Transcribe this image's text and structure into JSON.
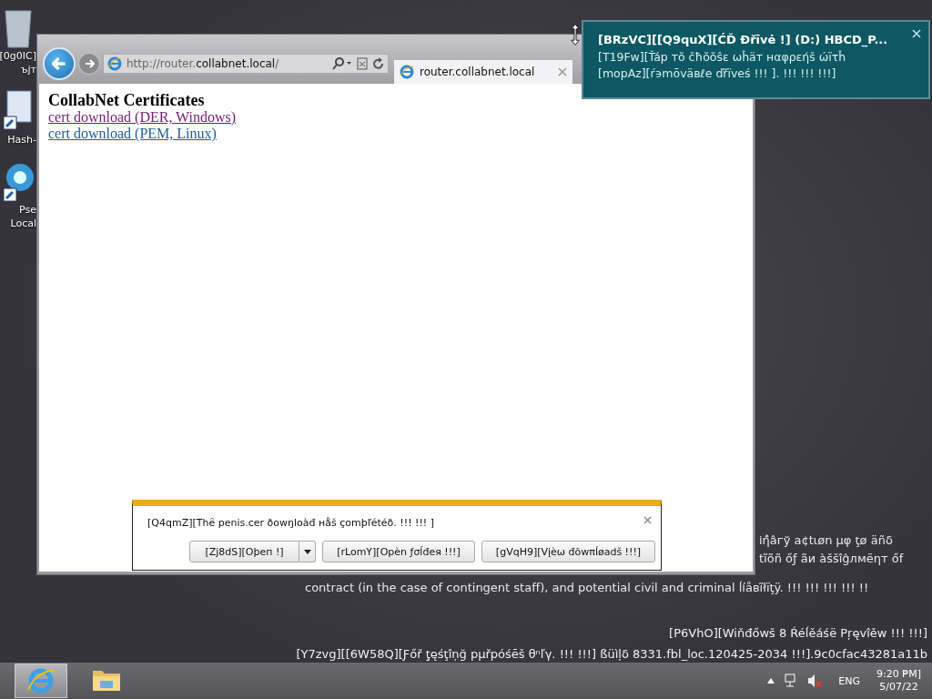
{
  "desktop": {
    "icons": [
      {
        "kind": "bin",
        "lines": [
          "[0g0IC]",
          "ъjт"
        ]
      },
      {
        "kind": "shortcut",
        "lines": [
          "Hash-"
        ]
      },
      {
        "kind": "ie",
        "lines": [
          "Pse",
          "Local"
        ]
      }
    ],
    "legal_lines": [
      "іή̂âгў a¢tιøn µφ ţø äñδ",
      "tĩõñ őƒ ãи àššîĝлмëηт őf",
      "contract (in the case of contingent staff), and potential civil and criminal ĺíåвĩłïţÿ. !!! !!! !!! !!! !!"
    ],
    "build_lines": [
      "[P6VhO][Wiňđőwš 8 Ŕéĺěáśë Pŗęvîěw !!! !!!]",
      "[Y7zvg][[6W58Q][Ƒőř ţ̧ęśţîņğ pµřpóśēš θⁿľγ. !!! !!!] ßüìļδ 8331.fbl_loc.120425-2034 !!!].9c0cfac43281a11b"
    ]
  },
  "browser": {
    "url": {
      "prefix": "http://router.",
      "domain": "collabnet.local",
      "suffix": "/"
    },
    "tab": {
      "title": "router.collabnet.local",
      "selected": true
    },
    "page": {
      "heading": "CollabNet Certificates",
      "links": [
        {
          "text": "cert download (DER, Windows)",
          "visited": true
        },
        {
          "text": "cert download (PEM, Linux)",
          "visited": false
        }
      ]
    }
  },
  "download_bar": {
    "message": "[Q4qmZ][Thȇ penis.cer ðowŋloàđ нåš çomþľétéð. !!! !!! ]",
    "buttons": [
      {
        "kind": "split",
        "label": "[Zj8dS][Oþeп !]"
      },
      {
        "kind": "plain",
        "label": "[rLomY][Opèn ƒσĺđeя !!!]"
      },
      {
        "kind": "plain",
        "label": "[gVqH9][Vįèω đõwπĺøadš !!!]"
      }
    ]
  },
  "notification": {
    "title": "[BRzVC][[Q9quX][ĆĎ Đřīvė !] (D:) HBCD_P...",
    "body": "[T19Fw][Ťáp тŏ čħŏŏŝε ωĥäт нαφρεήš ώïτĥ [mopAz][ŕ϶mōväвℓe ďřïveś !!! ]. !!! !!! !!!]"
  },
  "taskbar": {
    "apps": [
      {
        "kind": "ie",
        "selected": true
      },
      {
        "kind": "explorer",
        "selected": false
      }
    ],
    "tray": {
      "muted": true,
      "language": "ENG",
      "time": "9:20 ₱M]",
      "date": "5/07/22"
    }
  }
}
